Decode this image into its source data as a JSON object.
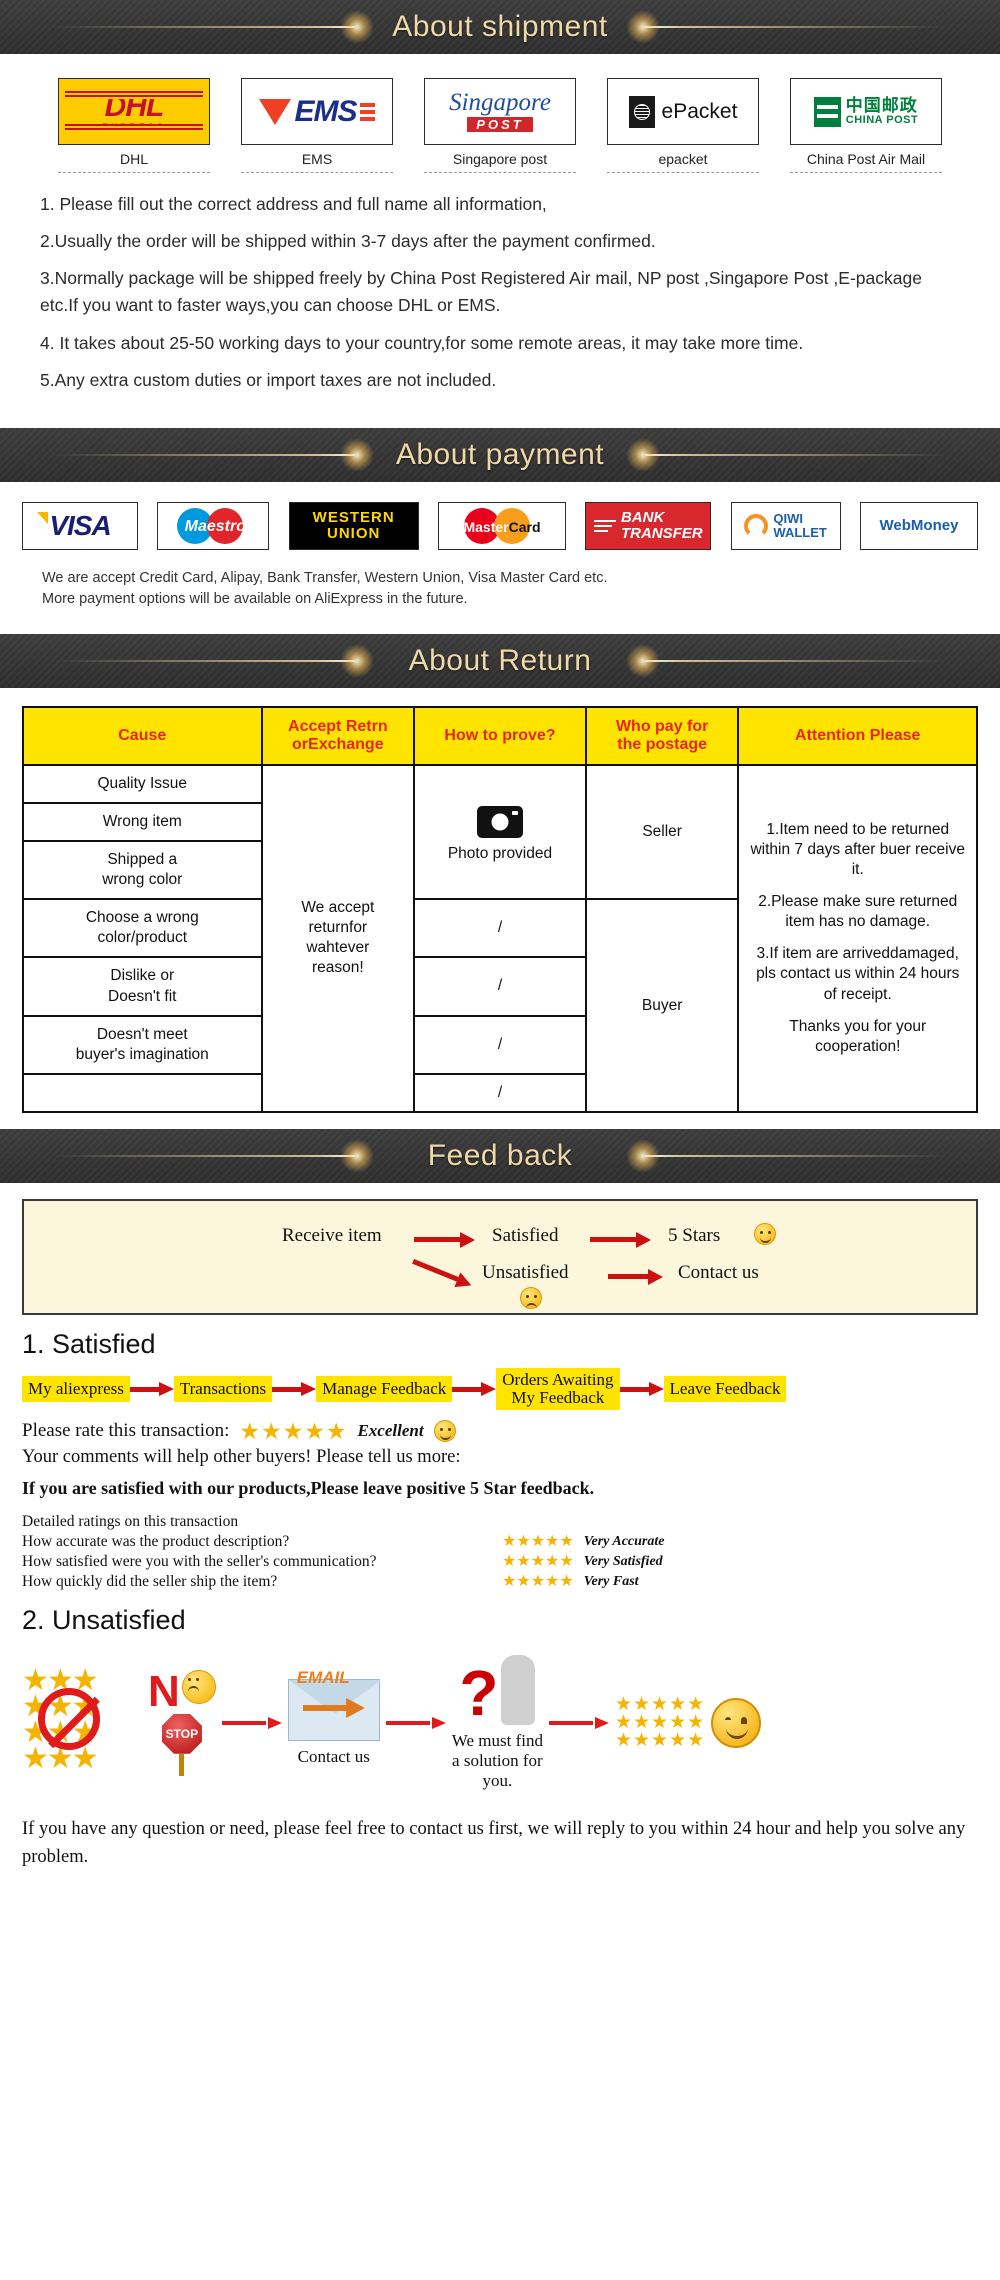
{
  "sections": {
    "shipment_title": "About shipment",
    "payment_title": "About payment",
    "return_title": "About Return",
    "feedback_title": "Feed back"
  },
  "shipment": {
    "carriers": [
      {
        "name": "DHL",
        "logo": "dhl-logo",
        "mark": "DHL",
        "sub": "EXPRESS"
      },
      {
        "name": "EMS",
        "logo": "ems-logo",
        "mark": "EMS",
        "sub": ""
      },
      {
        "name": "Singapore post",
        "logo": "singapore-post-logo",
        "mark": "Singapore",
        "sub": "POST"
      },
      {
        "name": "epacket",
        "logo": "epacket-logo",
        "mark": "ePacket",
        "sub": ""
      },
      {
        "name": "China Post Air Mail",
        "logo": "china-post-logo",
        "mark": "中国邮政",
        "sub": "CHINA POST"
      }
    ],
    "notes": [
      "1. Please fill out the correct address and full name all information,",
      "2.Usually the order will be shipped within 3-7 days after the payment confirmed.",
      "3.Normally package will be shipped freely by China Post Registered Air mail, NP post ,Singapore Post ,E-package etc.If you want to faster ways,you can choose DHL or EMS.",
      "4. It takes about 25-50 working days to your country,for some remote areas, it may take more time.",
      "5.Any extra custom duties or import taxes are not included."
    ]
  },
  "payment": {
    "methods": [
      {
        "name": "VISA",
        "logo": "visa-logo"
      },
      {
        "name": "Maestro",
        "logo": "maestro-logo"
      },
      {
        "name": "WESTERN UNION",
        "logo": "western-union-logo",
        "line1": "WESTERN",
        "line2": "UNION"
      },
      {
        "name": "MasterCard",
        "logo": "mastercard-logo",
        "part1": "Master",
        "part2": "Card"
      },
      {
        "name": "BANK TRANSFER",
        "logo": "bank-transfer-logo",
        "line1": "BANK",
        "line2": "TRANSFER"
      },
      {
        "name": "QIWI WALLET",
        "logo": "qiwi-wallet-logo",
        "line1": "QIWI",
        "line2": "WALLET"
      },
      {
        "name": "WebMoney",
        "logo": "webmoney-logo"
      }
    ],
    "notes": [
      "We are accept Credit Card, Alipay, Bank Transfer, Western Union, Visa Master Card etc.",
      "More payment options will be available on AliExpress in the future."
    ]
  },
  "return_table": {
    "headers": [
      "Cause",
      "Accept Retrn orExchange",
      "How to prove?",
      "Who pay for the postage",
      "Attention Please"
    ],
    "headers_lines": [
      [
        "Cause"
      ],
      [
        "Accept Retrn",
        "orExchange"
      ],
      [
        "How to prove?"
      ],
      [
        "Who pay for",
        "the postage"
      ],
      [
        "Attention Please"
      ]
    ],
    "causes": [
      [
        "Quality Issue"
      ],
      [
        "Wrong item"
      ],
      [
        "Shipped a",
        "wrong color"
      ],
      [
        "Choose a wrong",
        "color/product"
      ],
      [
        "Dislike or",
        "Doesn't fit"
      ],
      [
        "Doesn't meet",
        "buyer's imagination"
      ],
      [
        ""
      ]
    ],
    "accept_cell": [
      "We accept",
      "returnfor",
      "wahtever",
      "reason!"
    ],
    "proof_photo_label": "Photo provided",
    "proof_slash": "/",
    "payer_seller": "Seller",
    "payer_buyer": "Buyer",
    "attention": [
      "1.Item need to be returned within 7 days after buer receive it.",
      "2.Please make sure returned item has no damage.",
      "3.If item are arriveddamaged, pls contact us within 24 hours of receipt.",
      "Thanks you for your cooperation!"
    ]
  },
  "feedback": {
    "flow": {
      "receive": "Receive item",
      "satisfied": "Satisfied",
      "five_stars": "5 Stars",
      "unsatisfied": "Unsatisfied",
      "contact": "Contact us"
    },
    "satisfied_heading": "1. Satisfied",
    "breadcrumb": [
      {
        "label": "My aliexpress"
      },
      {
        "label": "Transactions"
      },
      {
        "label": "Manage Feedback"
      },
      {
        "label": "Orders Awaiting My Feedback",
        "line1": "Orders Awaiting",
        "line2": "My Feedback"
      },
      {
        "label": "Leave Feedback"
      }
    ],
    "rate_prompt": "Please rate this transaction:",
    "rate_stars": "★★★★★",
    "rate_label": "Excellent",
    "comments_line": "Your comments will help other buyers! Please tell us more:",
    "positive_line": "If you are satisfied with our products,Please leave positive 5 Star feedback.",
    "ratings_heading": "Detailed ratings on this transaction",
    "ratings": [
      {
        "question": "How accurate was the product description?",
        "stars": "★★★★★",
        "label": "Very Accurate"
      },
      {
        "question": "How satisfied were you with the seller's communication?",
        "stars": "★★★★★",
        "label": "Very Satisfied"
      },
      {
        "question": "How quickly did the seller ship the item?",
        "stars": "★★★★★",
        "label": "Very Fast"
      }
    ],
    "unsatisfied_heading": "2. Unsatisfied",
    "unsat_flow": {
      "no": "N",
      "stop": "STOP",
      "email": "EMAIL",
      "contact_caption": "Contact us",
      "solution_caption": "We must find a solution for you.",
      "solution_lines": [
        "We must find",
        "a solution for",
        "you."
      ],
      "stars_block": "★★★★★"
    },
    "closing": "If you have any question or need, please feel free to contact us first, we will reply to you within 24 hour and help you solve any problem."
  },
  "colors": {
    "banner_bg": "#333333",
    "banner_text": "#f0d9a8",
    "table_header_bg": "#ffe400",
    "table_header_text": "#e8261c",
    "highlight": "#ffe400",
    "arrow_red": "#cc1111",
    "star_gold": "#f5b400",
    "feedback_box_bg": "#fcf7dc"
  }
}
